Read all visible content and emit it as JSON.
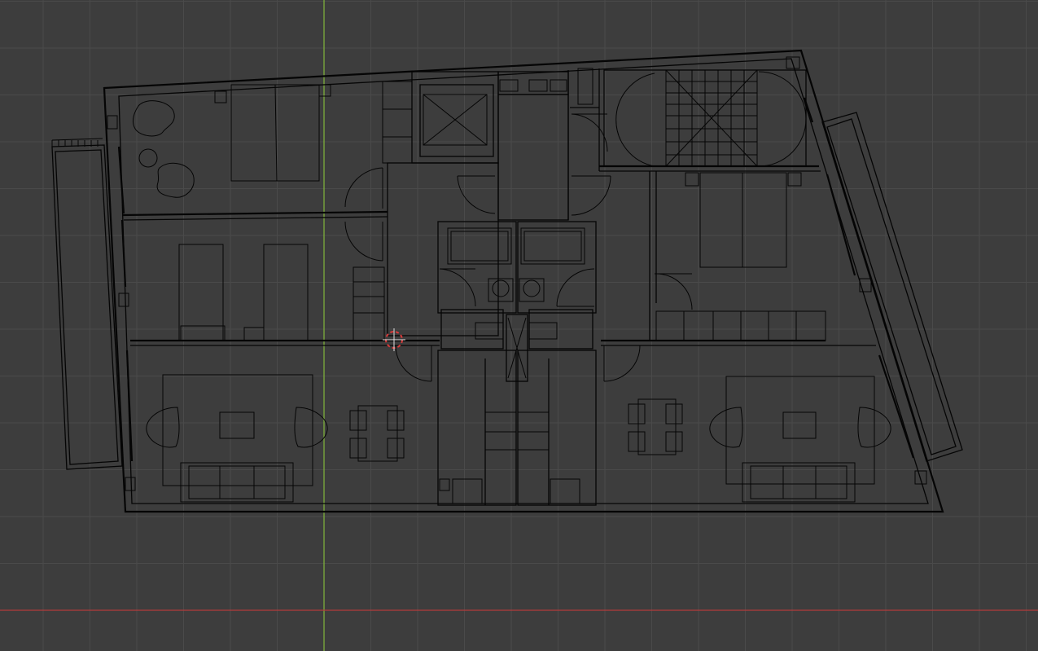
{
  "viewport": {
    "background": "#3d3d3d",
    "grid_color": "#4a4a4a",
    "axis_x_color": "#b33b3b",
    "axis_y_color": "#7dae3c",
    "drawing_color": "#050505",
    "cursor_color": "#e0e0e0",
    "cursor_accent_color": "#d83a3a"
  },
  "icons": {
    "cursor": "3d-cursor-icon"
  }
}
